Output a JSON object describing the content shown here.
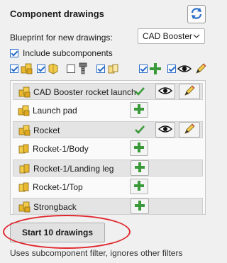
{
  "panel": {
    "title": "Component drawings",
    "refresh_icon": "refresh-icon"
  },
  "blueprint": {
    "label": "Blueprint for new drawings:",
    "selected": "CAD Booster"
  },
  "include_subcomponents": {
    "label": "Include subcomponents",
    "checked": true
  },
  "filters": [
    {
      "icon": "assembly-icon",
      "checked": true
    },
    {
      "icon": "part-icon",
      "checked": true
    },
    {
      "icon": "toolbox-screw-icon",
      "checked": false
    },
    {
      "icon": "virtual-part-icon",
      "checked": true
    },
    {
      "icon": "add-icon",
      "checked": true
    },
    {
      "icon": "eye-icon",
      "checked": true
    },
    {
      "icon": "pencil-icon",
      "checked": false
    }
  ],
  "components": [
    {
      "name": "CAD Booster rocket launch",
      "type": "assembly",
      "has_drawing": true
    },
    {
      "name": "Launch pad",
      "type": "assembly",
      "has_drawing": false
    },
    {
      "name": "Rocket",
      "type": "assembly",
      "has_drawing": true
    },
    {
      "name": "Rocket-1/Body",
      "type": "part",
      "has_drawing": false
    },
    {
      "name": "Rocket-1/Landing leg",
      "type": "part",
      "has_drawing": false
    },
    {
      "name": "Rocket-1/Top",
      "type": "part",
      "has_drawing": false
    },
    {
      "name": "Strongback",
      "type": "assembly",
      "has_drawing": false
    }
  ],
  "start_button": {
    "label": "Start 10 drawings"
  },
  "hint": "Uses subcomponent filter, ignores other filters",
  "colors": {
    "accent_green": "#3a9a3a",
    "check_blue": "#2a6cc8",
    "highlight_red": "#e0262d",
    "part_yellow": "#e8b830"
  }
}
